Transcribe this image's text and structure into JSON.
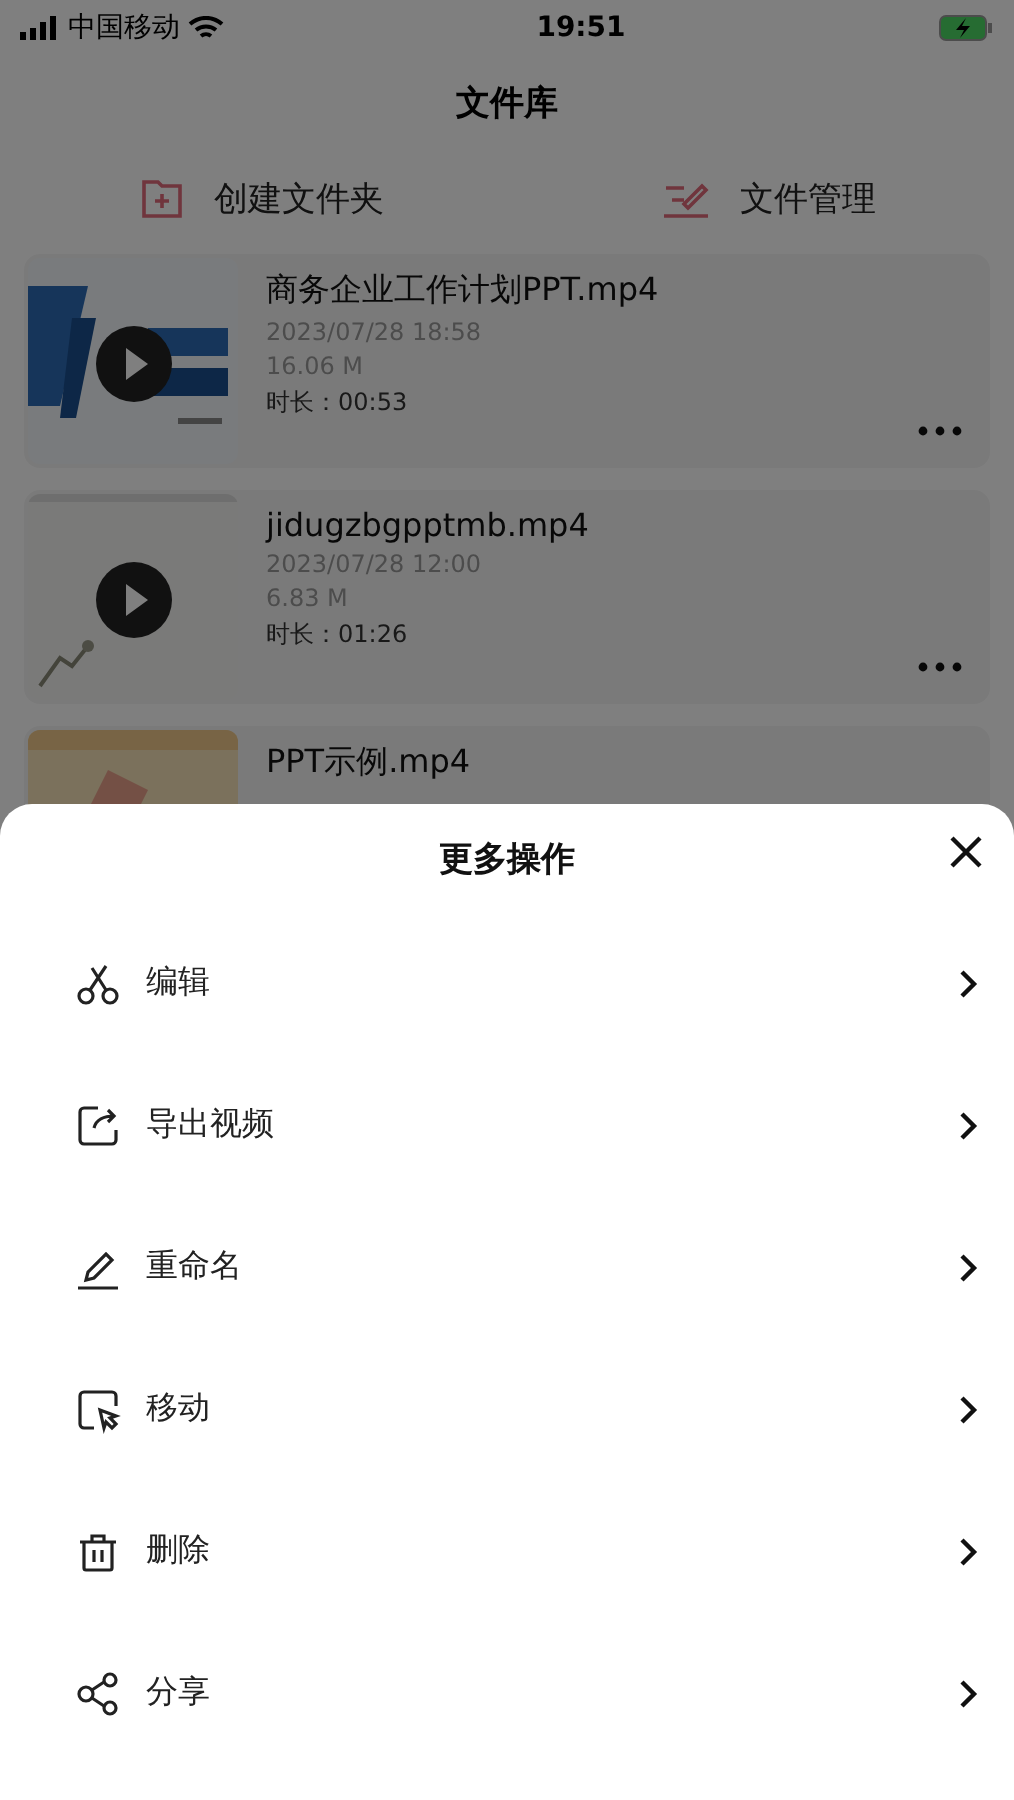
{
  "status_bar": {
    "carrier": "中国移动",
    "time": "19:51"
  },
  "title": "文件库",
  "actions": [
    {
      "kind": "new-folder",
      "label": "创建文件夹"
    },
    {
      "kind": "manage",
      "label": "文件管理"
    }
  ],
  "files": [
    {
      "name": "商务企业工作计划PPT.mp4",
      "date": "2023/07/28 18:58",
      "size": "16.06 M",
      "duration": "时长：00:53"
    },
    {
      "name": "jidugzbgpptmb.mp4",
      "date": "2023/07/28 12:00",
      "size": "6.83 M",
      "duration": "时长：01:26"
    },
    {
      "name": "PPT示例.mp4"
    }
  ],
  "sheet": {
    "title": "更多操作",
    "items": [
      {
        "kind": "edit",
        "label": "编辑"
      },
      {
        "kind": "export",
        "label": "导出视频"
      },
      {
        "kind": "rename",
        "label": "重命名"
      },
      {
        "kind": "move",
        "label": "移动"
      },
      {
        "kind": "delete",
        "label": "删除"
      },
      {
        "kind": "share",
        "label": "分享"
      }
    ]
  }
}
